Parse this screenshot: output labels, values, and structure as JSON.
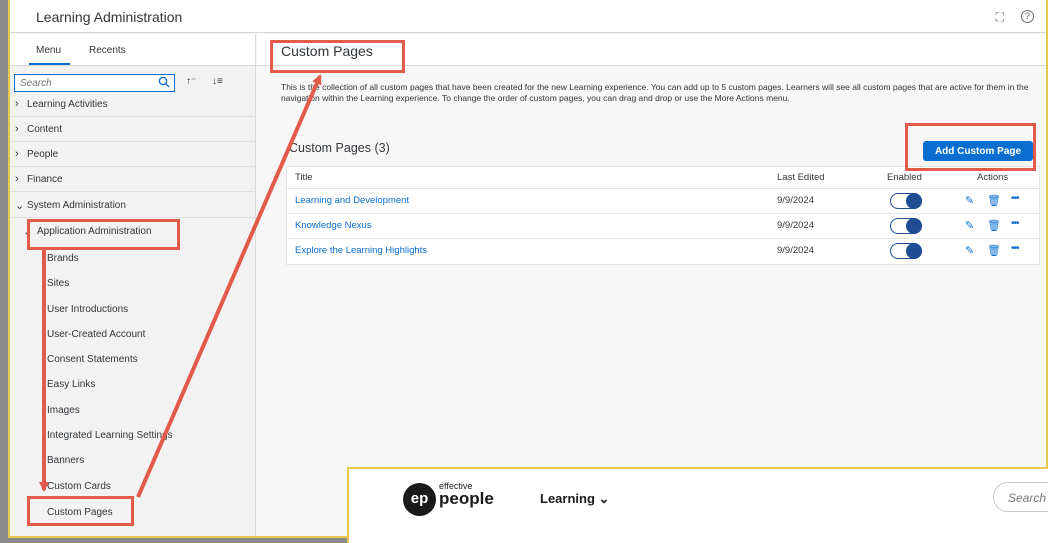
{
  "shell": {
    "title": "Learning Administration"
  },
  "sidebar": {
    "tabs": [
      "Menu",
      "Recents"
    ],
    "search_placeholder": "Search",
    "sort_asc": "↑⁻",
    "sort_desc": "↓≡",
    "items": [
      "Learning Activities",
      "Content",
      "People",
      "Finance",
      "System Administration",
      "Application Administration"
    ],
    "sub_items": [
      "Brands",
      "Sites",
      "User Introductions",
      "User-Created Account",
      "Consent Statements",
      "Easy Links",
      "Images",
      "Integrated Learning Settings",
      "Banners",
      "Custom Cards",
      "Custom Pages"
    ]
  },
  "main": {
    "title": "Custom Pages",
    "description": "This is the collection of all custom pages that have been created for the new Learning experience. You can add up to 5 custom pages. Learners will see all custom pages that are active for them in the navigation within the Learning experience. To change the order of custom pages, you can drag and drop or use the More Actions menu.",
    "section_title": "Custom Pages (3)",
    "add_button": "Add Custom Page",
    "columns": [
      "Title",
      "Last Edited",
      "Enabled",
      "Actions"
    ],
    "rows": [
      {
        "title": "Learning and Development",
        "date": "9/9/2024",
        "enabled": true
      },
      {
        "title": "Knowledge Nexus",
        "date": "9/9/2024",
        "enabled": true
      },
      {
        "title": "Explore the Learning Highlights",
        "date": "9/9/2024",
        "enabled": true
      }
    ]
  },
  "overlay": {
    "logo_mark": "ep",
    "brand_small": "effective",
    "brand_big": "people",
    "menu_label": "Learning",
    "search_placeholder": "Search t"
  },
  "icons": {
    "search": "search-icon",
    "edit": "pencil-icon",
    "delete": "trash-icon",
    "more": "ellipsis-icon",
    "expand": "expand-icon",
    "help": "help-icon"
  },
  "colors": {
    "accent": "#0a6ed1",
    "annotation": "#e15a4a",
    "frame": "#e6c84b",
    "toggle": "#1f4d94"
  }
}
